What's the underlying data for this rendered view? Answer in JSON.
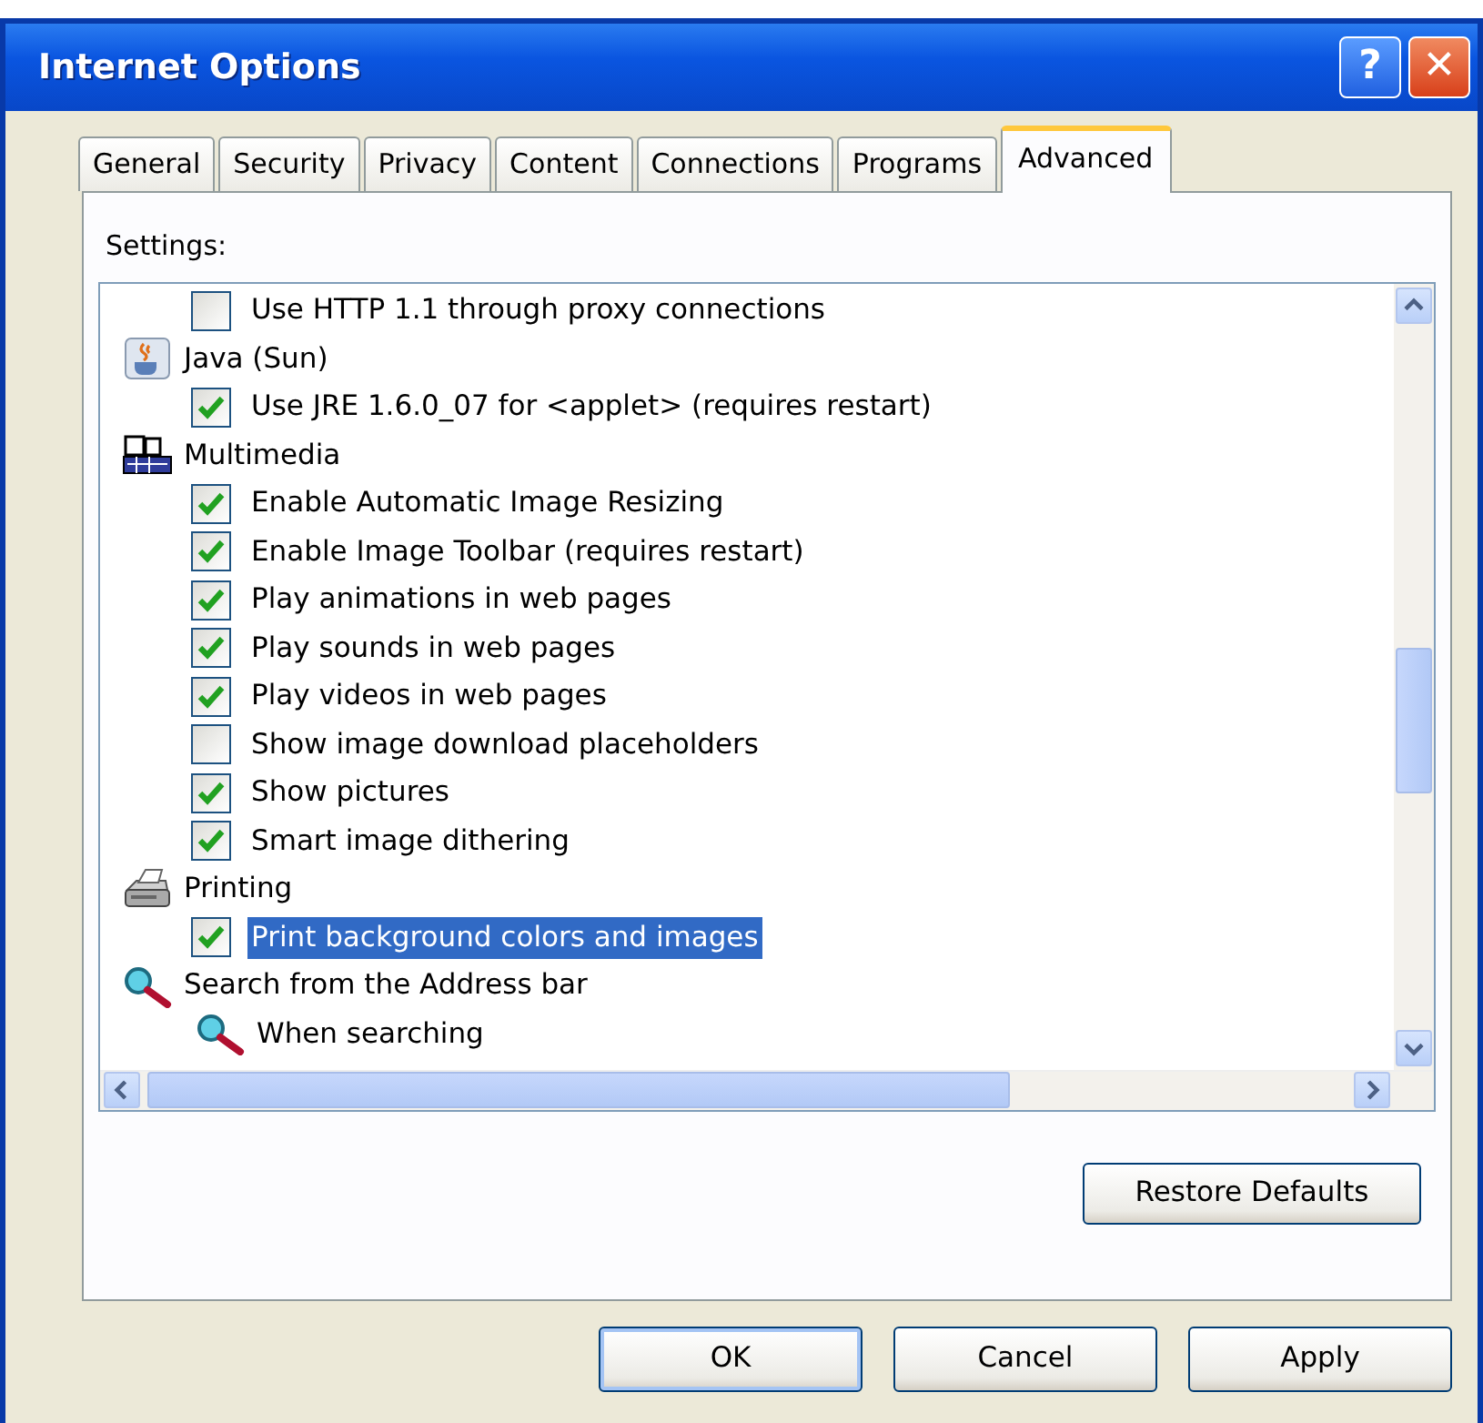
{
  "window": {
    "title": "Internet Options",
    "title_buttons": [
      "?",
      "✕"
    ]
  },
  "tabs": [
    {
      "label": "General",
      "selected": false
    },
    {
      "label": "Security",
      "selected": false
    },
    {
      "label": "Privacy",
      "selected": false
    },
    {
      "label": "Content",
      "selected": false
    },
    {
      "label": "Connections",
      "selected": false
    },
    {
      "label": "Programs",
      "selected": false
    },
    {
      "label": "Advanced",
      "selected": true
    }
  ],
  "settings_label": "Settings:",
  "settings": [
    {
      "kind": "checkbox",
      "label": "Use HTTP 1.1 through proxy connections",
      "checked": false,
      "selected": false
    },
    {
      "kind": "category",
      "label": "Java (Sun)",
      "selected": false,
      "children": [
        {
          "kind": "checkbox",
          "label": "Use JRE 1.6.0_07 for <applet> (requires restart)",
          "checked": true,
          "selected": false
        }
      ]
    },
    {
      "kind": "category",
      "label": "Multimedia",
      "selected": false,
      "children": [
        {
          "kind": "checkbox",
          "label": "Enable Automatic Image Resizing",
          "checked": true,
          "selected": false
        },
        {
          "kind": "checkbox",
          "label": "Enable Image Toolbar (requires restart)",
          "checked": true,
          "selected": false
        },
        {
          "kind": "checkbox",
          "label": "Play animations in web pages",
          "checked": true,
          "selected": false
        },
        {
          "kind": "checkbox",
          "label": "Play sounds in web pages",
          "checked": true,
          "selected": false
        },
        {
          "kind": "checkbox",
          "label": "Play videos in web pages",
          "checked": true,
          "selected": false
        },
        {
          "kind": "checkbox",
          "label": "Show image download placeholders",
          "checked": false,
          "selected": false
        },
        {
          "kind": "checkbox",
          "label": "Show pictures",
          "checked": true,
          "selected": false
        },
        {
          "kind": "checkbox",
          "label": "Smart image dithering",
          "checked": true,
          "selected": false
        }
      ]
    },
    {
      "kind": "category",
      "label": "Printing",
      "selected": false,
      "children": [
        {
          "kind": "checkbox",
          "label": "Print background colors and images",
          "checked": true,
          "selected": true
        }
      ]
    },
    {
      "kind": "category",
      "label": "Search from the Address bar",
      "selected": false,
      "children": [
        {
          "kind": "category",
          "label": "When searching",
          "selected": false
        }
      ]
    }
  ],
  "restore_button": "Restore Defaults",
  "buttons": [
    "OK",
    "Cancel",
    "Apply"
  ]
}
